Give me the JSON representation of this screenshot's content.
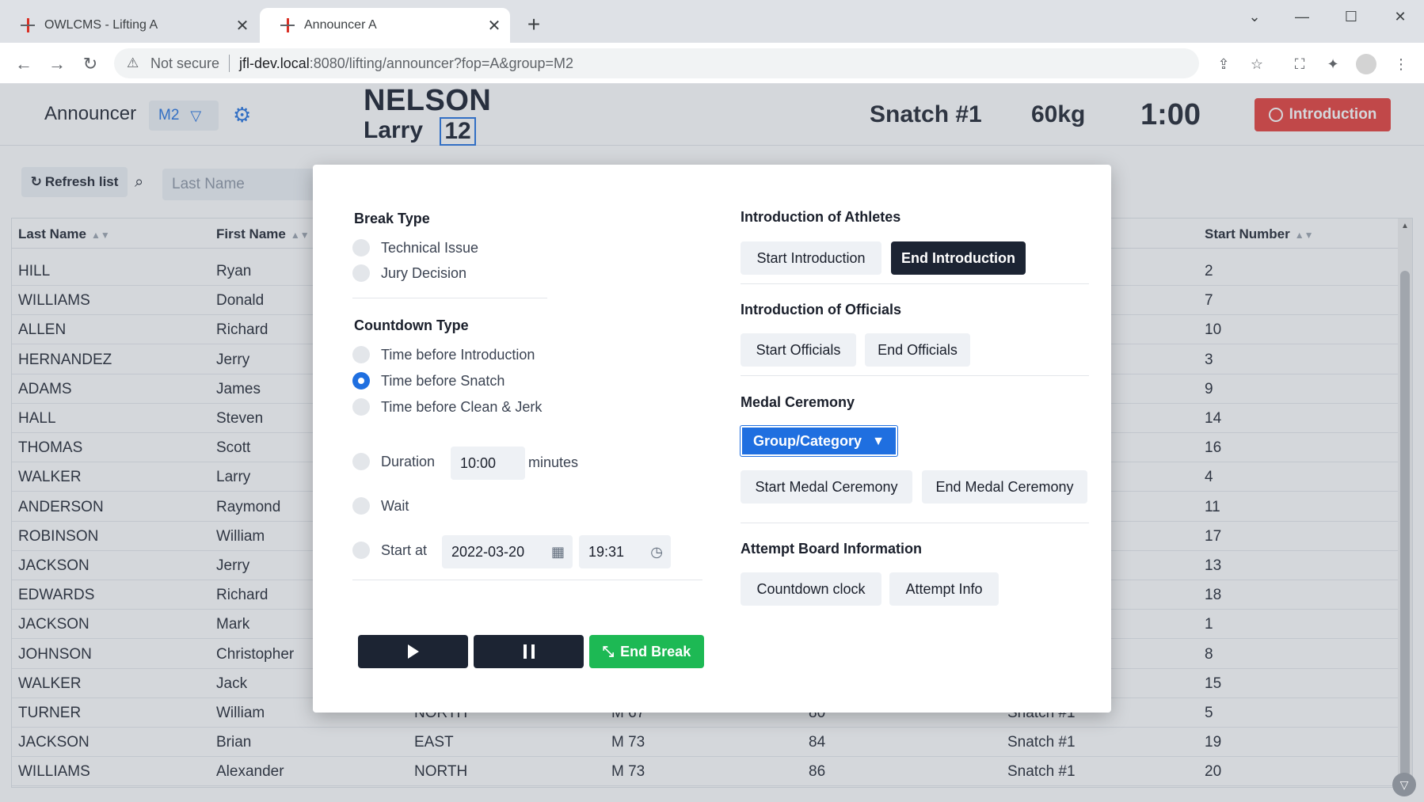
{
  "browser": {
    "tabs": [
      {
        "title": "OWLCMS - Lifting A"
      },
      {
        "title": "Announcer A"
      }
    ],
    "address": {
      "security": "Not secure",
      "host": "jfl-dev.local",
      "rest": ":8080/lifting/announcer?fop=A&group=M2"
    }
  },
  "header": {
    "title": "Announcer",
    "group": "M2",
    "athlete_last": "NELSON",
    "athlete_first": "Larry",
    "start_number": "12",
    "attempt": "Snatch #1",
    "weight": "60kg",
    "clock": "1:00",
    "break_button": "Introduction"
  },
  "toolbar": {
    "refresh_label": "Refresh list",
    "search_placeholder": "Last Name"
  },
  "grid": {
    "headers": {
      "last_name": "Last Name",
      "first_name": "First Name",
      "start_number": "Start Number"
    },
    "rows": [
      [
        "HILL",
        "Ryan",
        "",
        "",
        "",
        "",
        "2"
      ],
      [
        "WILLIAMS",
        "Donald",
        "",
        "",
        "",
        "",
        "7"
      ],
      [
        "ALLEN",
        "Richard",
        "",
        "",
        "",
        "",
        "10"
      ],
      [
        "HERNANDEZ",
        "Jerry",
        "",
        "",
        "",
        "",
        "3"
      ],
      [
        "ADAMS",
        "James",
        "",
        "",
        "",
        "",
        "9"
      ],
      [
        "HALL",
        "Steven",
        "",
        "",
        "",
        "",
        "14"
      ],
      [
        "THOMAS",
        "Scott",
        "",
        "",
        "",
        "",
        "16"
      ],
      [
        "WALKER",
        "Larry",
        "",
        "",
        "",
        "",
        "4"
      ],
      [
        "ANDERSON",
        "Raymond",
        "",
        "",
        "",
        "",
        "11"
      ],
      [
        "ROBINSON",
        "William",
        "",
        "",
        "",
        "",
        "17"
      ],
      [
        "JACKSON",
        "Jerry",
        "",
        "",
        "",
        "",
        "13"
      ],
      [
        "EDWARDS",
        "Richard",
        "",
        "",
        "",
        "",
        "18"
      ],
      [
        "JACKSON",
        "Mark",
        "",
        "",
        "",
        "",
        "1"
      ],
      [
        "JOHNSON",
        "Christopher",
        "",
        "",
        "",
        "",
        "8"
      ],
      [
        "WALKER",
        "Jack",
        "",
        "",
        "",
        "",
        "15"
      ],
      [
        "TURNER",
        "William",
        "NORTH",
        "M 67",
        "80",
        "Snatch #1",
        "5"
      ],
      [
        "JACKSON",
        "Brian",
        "EAST",
        "M 73",
        "84",
        "Snatch #1",
        "19"
      ],
      [
        "WILLIAMS",
        "Alexander",
        "NORTH",
        "M 73",
        "86",
        "Snatch #1",
        "20"
      ]
    ]
  },
  "dialog": {
    "break_type": {
      "title": "Break Type",
      "options": [
        "Technical Issue",
        "Jury Decision"
      ]
    },
    "countdown_type": {
      "title": "Countdown Type",
      "options": [
        "Time before Introduction",
        "Time before Snatch",
        "Time before Clean & Jerk"
      ],
      "selected": 1
    },
    "duration": {
      "label": "Duration",
      "value": "10:00",
      "unit": "minutes"
    },
    "wait": {
      "label": "Wait"
    },
    "start_at": {
      "label": "Start at",
      "date": "2022-03-20",
      "time": "19:31"
    },
    "controls": {
      "end_break": "End Break"
    },
    "intro_athletes": {
      "title": "Introduction of Athletes",
      "start": "Start Introduction",
      "end": "End Introduction"
    },
    "intro_officials": {
      "title": "Introduction of Officials",
      "start": "Start Officials",
      "end": "End Officials"
    },
    "medal": {
      "title": "Medal Ceremony",
      "combo": "Group/Category",
      "start": "Start Medal Ceremony",
      "end": "End Medal Ceremony"
    },
    "attempt_board": {
      "title": "Attempt Board Information",
      "countdown": "Countdown clock",
      "attempt_info": "Attempt Info"
    }
  }
}
